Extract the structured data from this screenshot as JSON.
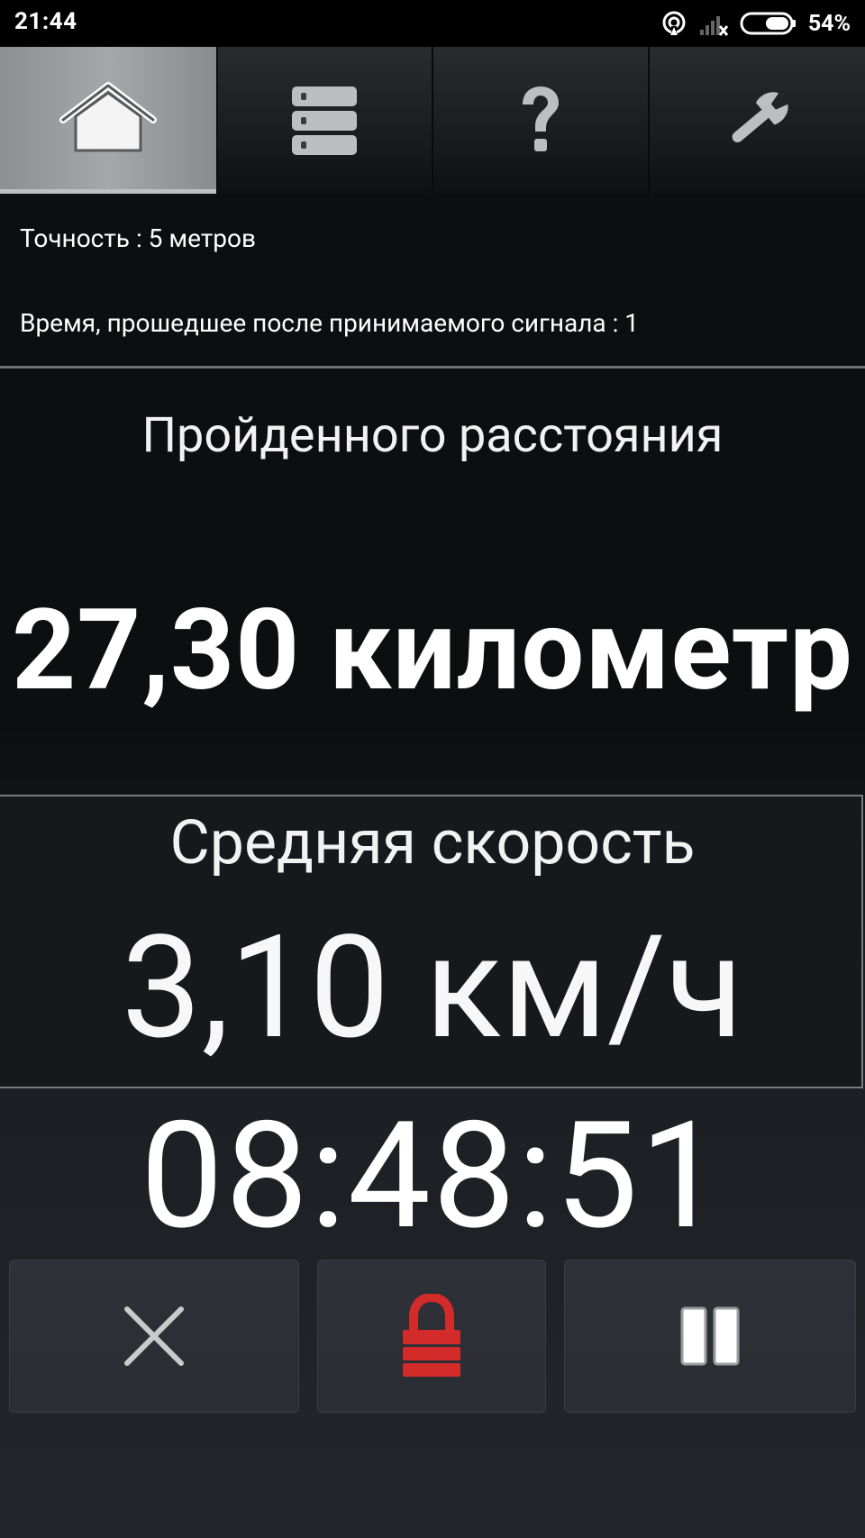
{
  "status_bar": {
    "time": "21:44",
    "battery_percent": "54%",
    "icons": [
      "hotspot-icon",
      "signal-icon",
      "battery-icon"
    ]
  },
  "tabs": [
    {
      "icon": "home-icon",
      "selected": true
    },
    {
      "icon": "list-icon",
      "selected": false
    },
    {
      "icon": "help-icon",
      "selected": false
    },
    {
      "icon": "settings-wrench-icon",
      "selected": false
    }
  ],
  "info": {
    "accuracy": "Точность : 5 метров",
    "time_since_signal": "Время, прошедшее после принимаемого сигнала : 1"
  },
  "distance": {
    "label": "Пройденного расстояния",
    "value": "27,30 километр"
  },
  "speed": {
    "label": "Средняя скорость",
    "value": "3,10 км/ч"
  },
  "timer": {
    "value": "08:48:51"
  },
  "controls": [
    {
      "name": "cancel",
      "icon": "close-icon"
    },
    {
      "name": "lock",
      "icon": "lock-icon",
      "color": "#d32a2a"
    },
    {
      "name": "pause",
      "icon": "pause-icon"
    }
  ]
}
